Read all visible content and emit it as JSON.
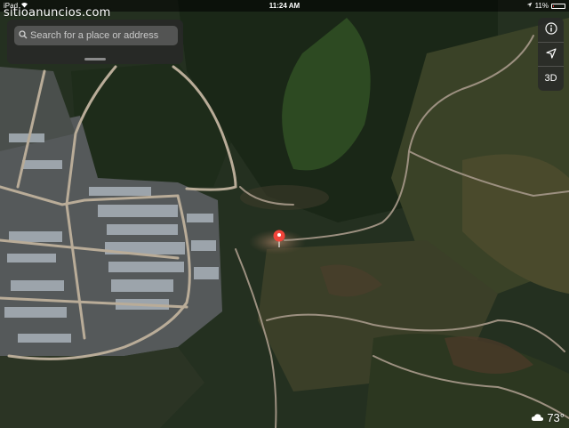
{
  "statusbar": {
    "device": "iPad",
    "time": "11:24 AM",
    "battery_text": "11%",
    "battery_level": 0.11,
    "battery_color": "#e33333",
    "location_icon": "location-arrow-icon"
  },
  "watermark": {
    "text": "sitioanuncios.com"
  },
  "search": {
    "placeholder": "Search for a place or address",
    "value": ""
  },
  "map_controls": {
    "info_icon": "info-icon",
    "tracking_icon": "location-arrow-icon",
    "view_3d_label": "3D"
  },
  "pin": {
    "icon": "map-pin-icon",
    "color": "#f0443a"
  },
  "weather": {
    "icon": "cloud-icon",
    "temperature": "73°"
  },
  "colors": {
    "forest_dark": "#1c2a1a",
    "forest": "#2c3a24",
    "clearing": "#5a4a36",
    "road": "#b9ac98",
    "rooftops": "#a9b2ba"
  }
}
